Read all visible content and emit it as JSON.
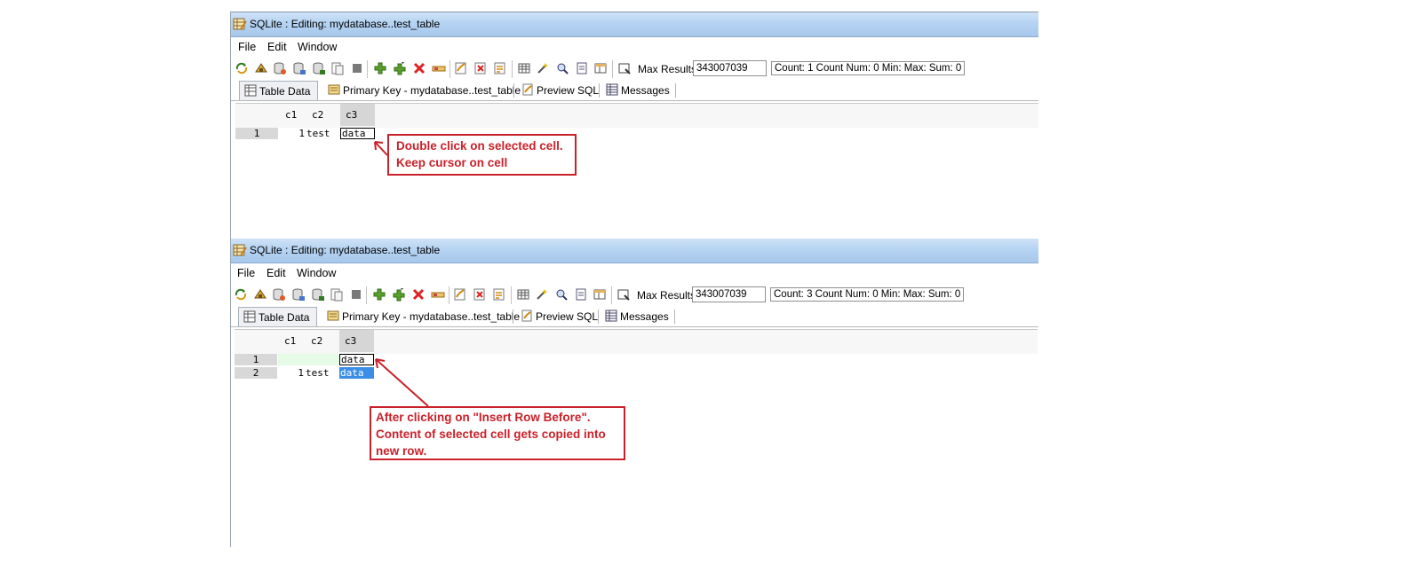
{
  "windows": [
    {
      "title": "SQLite : Editing: mydatabase..test_table",
      "menu": [
        "File",
        "Edit",
        "Window"
      ],
      "max_results_label": "Max Results:",
      "max_results_value": "343007039",
      "count_status": "Count: 1  Count Num: 0  Min:   Max:   Sum: 0",
      "tabs": [
        "Table Data",
        "Primary Key - mydatabase..test_table",
        "Preview SQL",
        "Messages"
      ],
      "columns": [
        "c1",
        "c2",
        "c3"
      ],
      "rows": [
        {
          "num": "1",
          "c1": "1",
          "c2": "test",
          "c3": "data"
        }
      ],
      "callout": [
        "Double click on selected cell.",
        "Keep cursor on cell"
      ]
    },
    {
      "title": "SQLite : Editing: mydatabase..test_table",
      "menu": [
        "File",
        "Edit",
        "Window"
      ],
      "max_results_label": "Max Results:",
      "max_results_value": "343007039",
      "count_status": "Count: 3  Count Num: 0  Min:   Max:   Sum: 0",
      "tabs": [
        "Table Data",
        "Primary Key - mydatabase..test_table",
        "Preview SQL",
        "Messages"
      ],
      "columns": [
        "c1",
        "c2",
        "c3"
      ],
      "rows": [
        {
          "num": "1",
          "c1": "",
          "c2": "",
          "c3": "data"
        },
        {
          "num": "2",
          "c1": "1",
          "c2": "test",
          "c3": "data"
        }
      ],
      "callout": [
        "After clicking on \"Insert Row Before\".",
        "Content of selected cell gets copied into",
        "new row."
      ]
    }
  ],
  "colors": {
    "callout_red": "#c9212a",
    "selection_blue": "#3a8ee6",
    "new_row_green": "#e6fbe6",
    "titlebar_blue": "#b5d3f2"
  },
  "toolbar_icons": [
    "refresh-icon",
    "reload-icon",
    "db-connect-icon",
    "db-disconnect-icon",
    "db-save-icon",
    "db-export-icon",
    "stop-icon",
    "add-row-icon",
    "insert-row-before-icon",
    "delete-row-icon",
    "edit-row-icon",
    "filter-icon",
    "sort-icon",
    "find-icon",
    "grid-icon",
    "wand-icon",
    "query-icon",
    "form-icon",
    "layout-icon",
    "options-icon"
  ]
}
